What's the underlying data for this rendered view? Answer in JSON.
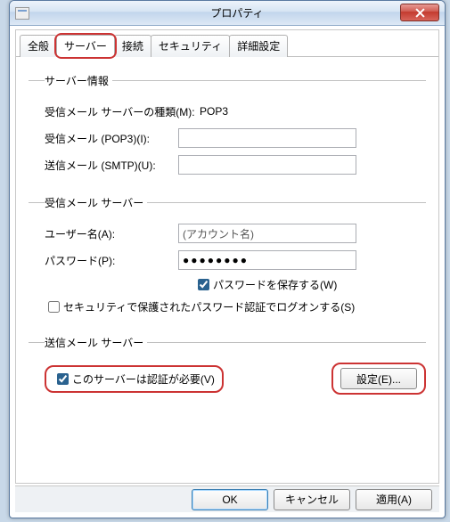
{
  "window": {
    "title": "プロパティ",
    "close_tooltip": "閉じる"
  },
  "tabs": {
    "general": "全般",
    "server": "サーバー",
    "connect": "接続",
    "security": "セキュリティ",
    "advanced": "詳細設定"
  },
  "serverinfo": {
    "legend": "サーバー情報",
    "incoming_type_label": "受信メール サーバーの種類(M):",
    "incoming_type_value": "POP3",
    "incoming_label": "受信メール (POP3)(I):",
    "incoming_value": "",
    "outgoing_label": "送信メール (SMTP)(U):",
    "outgoing_value": ""
  },
  "incoming": {
    "legend": "受信メール サーバー",
    "username_label": "ユーザー名(A):",
    "username_value": "(アカウント名)",
    "password_label": "パスワード(P):",
    "password_value": "●●●●●●●●",
    "remember_label": "パスワードを保存する(W)",
    "remember_checked": true,
    "spa_label": "セキュリティで保護されたパスワード認証でログオンする(S)",
    "spa_checked": false
  },
  "outgoing": {
    "legend": "送信メール サーバー",
    "auth_label": "このサーバーは認証が必要(V)",
    "auth_checked": true,
    "settings_button": "設定(E)..."
  },
  "footer": {
    "ok": "OK",
    "cancel": "キャンセル",
    "apply": "適用(A)"
  }
}
